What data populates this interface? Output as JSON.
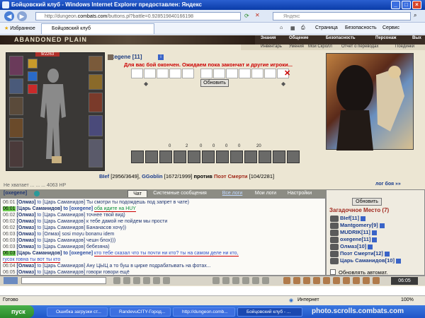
{
  "window": {
    "title": "Бойцовский клуб - Windows Internet Explorer предоставлен: Яндекс"
  },
  "addressbar": {
    "url_prefix": "http://dungeon.",
    "url_domain": "combats.com",
    "url_rest": "/buttons.pl?battle=0.928519840166198",
    "search_placeholder": "Яндекс"
  },
  "favbar": {
    "favorites": "Избранное",
    "tab": "Бойцовский клуб",
    "tools": [
      "Страница",
      "Безопасность",
      "Сервис"
    ]
  },
  "game": {
    "logo": "ABANDONED PLAIN",
    "topnav": [
      "Знания",
      "Общение",
      "Безопасность",
      "Персонаж",
      "Вых"
    ],
    "subnav": [
      "Инвентарь",
      "Умения",
      "Мой Скролл",
      "Отчет о переводах",
      "Поединки"
    ],
    "hp": "9/2263",
    "player": {
      "name": "oxegene",
      "level": "[11]"
    },
    "message": "Для вас бой окончен. Ожидаем пока закончат и другие игроки...",
    "refresh_button": "Обновить",
    "counters": [
      "0",
      "2",
      "0",
      "0",
      "0",
      "0",
      "20"
    ],
    "battle": {
      "team1": "BIef",
      "team1_hp": "[2956/3649]",
      "team1b": "GGoblin",
      "team1b_hp": "[1672/1999]",
      "vs": "против",
      "team2": "Поэт Смерти",
      "team2_hp": "[104/2281]"
    },
    "log_link": "лог боя »»",
    "partial_line": "Не хватает ... ... ... 4063 HP"
  },
  "chat": {
    "tabs": [
      "Чат",
      "Системные сообщения",
      "Все логи",
      "Мои логи",
      "Настройки"
    ],
    "header_name": "[oxegene]",
    "lines": [
      {
        "time": "06:01",
        "hl": false,
        "who": "[Олмаз]",
        "to": "to",
        "tonm": "[Царь Саманидов]",
        "text": "Ты смотри ты подождешь под запрет в чате)",
        "cls": "txt"
      },
      {
        "time": "06:01",
        "hl": true,
        "who": "[Царь Саманидов]",
        "to": "to [oxegene]",
        "tonm": "",
        "text": "оба идите на HUY",
        "cls": "green"
      },
      {
        "time": "06:02",
        "hl": false,
        "who": "[Олмаз]",
        "to": "to",
        "tonm": "[Царь Саманидов]",
        "text": "точнее твой вид)",
        "cls": "txt"
      },
      {
        "time": "06:02",
        "hl": false,
        "who": "[Олмаз]",
        "to": "to",
        "tonm": "[Царь Саманидов]",
        "text": "к тебе дамой не пойдем мы прости",
        "cls": "txt"
      },
      {
        "time": "06:02",
        "hl": false,
        "who": "[Олмаз]",
        "to": "to",
        "tonm": "[Царь Саманидов]",
        "text": "Бананасов хочу))",
        "cls": "txt"
      },
      {
        "time": "06:03",
        "hl": false,
        "who": "[Олмаз]",
        "to": "to",
        "tonm": "[Олмаз]",
        "text": "sosi moyu bonanu idem",
        "cls": "txt"
      },
      {
        "time": "06:03",
        "hl": false,
        "who": "[Олмаз]",
        "to": "to",
        "tonm": "[Царь Саманидов]",
        "text": "чешн блох)))",
        "cls": "txt"
      },
      {
        "time": "06:03",
        "hl": false,
        "who": "[Олмаз]",
        "to": "to",
        "tonm": "[Царь Саманидов]",
        "text": "бебезяна)",
        "cls": "txt"
      },
      {
        "time": "06:03",
        "hl": true,
        "who": "[Царь Саманидов]",
        "to": "to [oxegene]",
        "tonm": "",
        "text": "кто тебе сказал что ты почти ни кто? ты на самом деле ни кто,",
        "cls": "blue"
      },
      {
        "time": "",
        "hl": false,
        "who": "",
        "to": "",
        "tonm": "",
        "text": "гусок говна ты вот ты кто",
        "cls": "blue"
      },
      {
        "time": "06:04",
        "hl": false,
        "who": "[Олмаз]",
        "to": "to",
        "tonm": "[Царь Саманидов]",
        "text": "Ану ЦЫЦ а то буш в цирке подрабатывать на фотах...",
        "cls": "txt"
      },
      {
        "time": "06:05",
        "hl": false,
        "who": "[Олмаз]",
        "to": "to",
        "tonm": "[Царь Саманидов]",
        "text": "говори говори ещё",
        "cls": "txt"
      }
    ]
  },
  "right_panel": {
    "refresh": "Обновить",
    "place": "Загадочное Место (7)",
    "users": [
      {
        "name": "BIef",
        "lvl": "[11]"
      },
      {
        "name": "Mantgomery",
        "lvl": "[9]"
      },
      {
        "name": "MUDRIK",
        "lvl": "[11]"
      },
      {
        "name": "oxegene",
        "lvl": "[11]"
      },
      {
        "name": "Олмаз",
        "lvl": "[10]"
      },
      {
        "name": "Поэт Смерти",
        "lvl": "[12]"
      },
      {
        "name": "Царь Саманидов",
        "lvl": "[10]"
      }
    ],
    "auto_refresh": "Обновлять автомат."
  },
  "clock": "06:05",
  "statusbar": {
    "left": "Готово",
    "zone": "Интернет",
    "zoom": "100%"
  },
  "taskbar": {
    "start": "пуск",
    "tasks": [
      "Ошибка загрузки ст...",
      "RandevuCITY-Город...",
      "http://dungeon.comb...",
      "Бойцовский клуб - ..."
    ],
    "watermark": "photo.scrolls.combats.com"
  },
  "colors": {
    "accent": "#1e3470",
    "alert": "#cc0000",
    "highlight": "#6ccc50",
    "place": "#a0281e"
  }
}
